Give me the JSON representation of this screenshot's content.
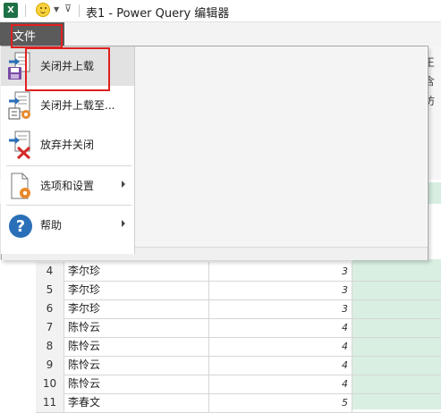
{
  "titlebar": {
    "app_icon": "excel-icon",
    "app_icon_text": "X",
    "smiley_icon": "smiley-face-icon",
    "title": "表1 - Power Query 编辑器"
  },
  "filetab": {
    "label": "文件"
  },
  "menu": {
    "items": [
      {
        "label": "关闭并上载",
        "icon": "close-and-load-icon",
        "selected": true
      },
      {
        "label": "关闭并上载至...",
        "icon": "close-and-load-to-icon",
        "selected": false
      },
      {
        "label": "放弃并关闭",
        "icon": "discard-and-close-icon",
        "selected": false
      },
      {
        "label": "选项和设置",
        "icon": "options-settings-icon",
        "submenu": true
      },
      {
        "label": "帮助",
        "icon": "help-icon",
        "submenu": true
      }
    ]
  },
  "ribbon_partial": {
    "glyph1": "王",
    "glyph2": "含",
    "glyph3": "仿"
  },
  "grid": {
    "rows": [
      {
        "idx": "4",
        "name": "李尔珍",
        "value": "3"
      },
      {
        "idx": "5",
        "name": "李尔珍",
        "value": "3"
      },
      {
        "idx": "6",
        "name": "李尔珍",
        "value": "3"
      },
      {
        "idx": "7",
        "name": "陈怜云",
        "value": "4"
      },
      {
        "idx": "8",
        "name": "陈怜云",
        "value": "4"
      },
      {
        "idx": "9",
        "name": "陈怜云",
        "value": "4"
      },
      {
        "idx": "10",
        "name": "陈怜云",
        "value": "4"
      },
      {
        "idx": "11",
        "name": "李春文",
        "value": "5"
      }
    ]
  },
  "colors": {
    "highlight": "#e02020",
    "file_tab": "#5b5b5b",
    "excel_green": "#1e7145",
    "data_green": "#d9efe2"
  }
}
